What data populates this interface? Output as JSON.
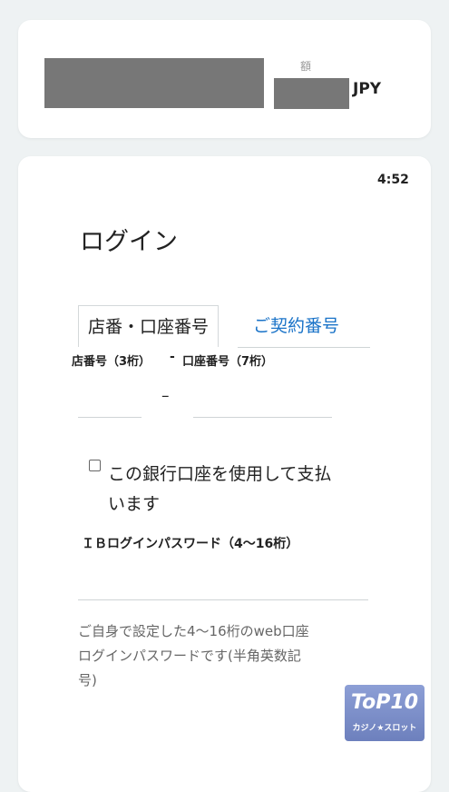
{
  "summary": {
    "amount_label": "額",
    "currency": "JPY"
  },
  "session": {
    "timer": "4:52"
  },
  "login": {
    "title": "ログイン",
    "tabs": [
      {
        "label": "店番・口座番号",
        "active": true
      },
      {
        "label": "ご契約番号",
        "active": false
      }
    ],
    "branch_label": "店番号（3桁）",
    "separator_label": "-",
    "account_label": "口座番号（7桁）",
    "field_dash": "–",
    "use_account_checkbox_line1": "この銀行口座を使用して支払",
    "use_account_checkbox_line2": "います",
    "use_account_checked": false,
    "password_label": "ＩＢログインパスワード（4〜16桁）",
    "password_value": "",
    "hint_line1": "ご自身で設定した4〜16桁のweb口座",
    "hint_line2": "ログインパスワードです(半角英数記",
    "hint_line3": "号)"
  },
  "watermark": {
    "brand": "ToP10",
    "sub": "カジノ★スロット"
  },
  "colors": {
    "accent": "#1a73c8",
    "redaction": "#777777"
  }
}
